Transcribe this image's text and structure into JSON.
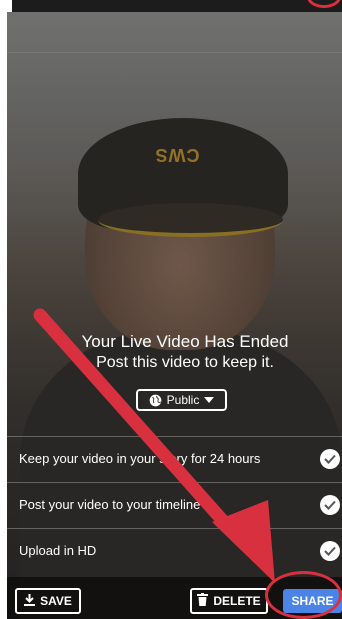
{
  "ended": {
    "title": "Your Live Video Has Ended",
    "subtitle": "Post this video to keep it."
  },
  "privacy": {
    "label": "Public",
    "icon": "globe-icon"
  },
  "options": [
    {
      "label": "Keep your video in your story for 24 hours",
      "checked": true
    },
    {
      "label": "Post your video to your timeline",
      "checked": true
    },
    {
      "label": "Upload in HD",
      "checked": true
    }
  ],
  "actions": {
    "save_label": "SAVE",
    "delete_label": "DELETE",
    "share_label": "SHARE"
  },
  "video": {
    "cap_text": "CWS"
  },
  "colors": {
    "annotation": "#d9303f",
    "share": "#4b83e6"
  }
}
